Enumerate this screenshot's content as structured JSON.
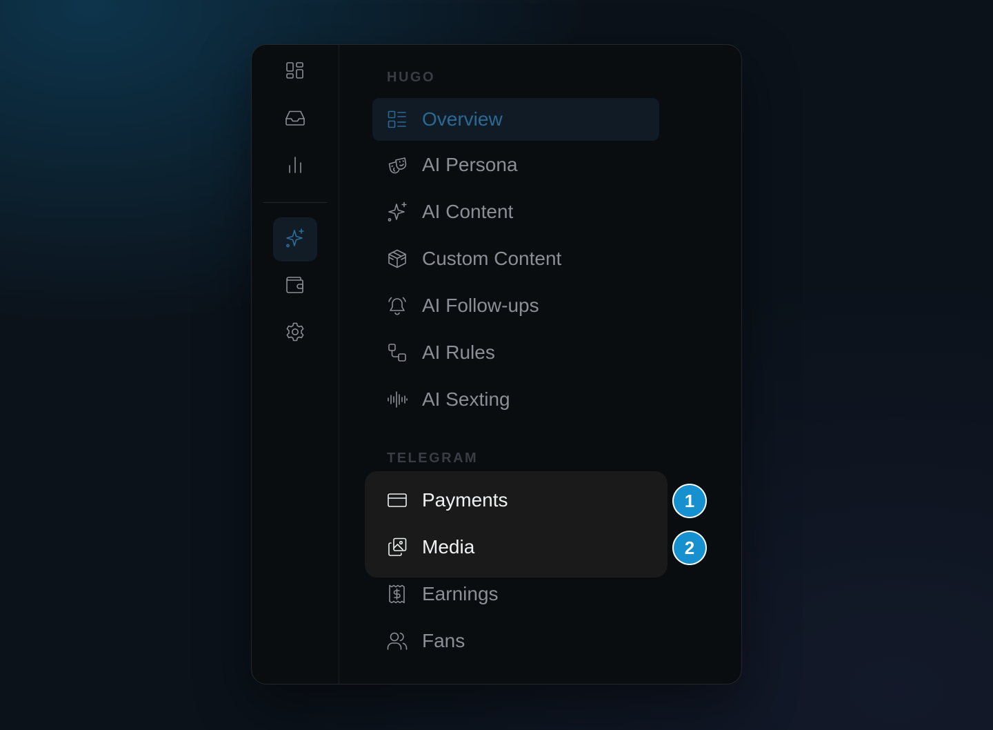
{
  "rail": {
    "items": [
      {
        "icon": "dashboard-grid-icon"
      },
      {
        "icon": "inbox-icon"
      },
      {
        "icon": "bar-chart-icon"
      },
      {
        "icon": "sparkles-icon",
        "active": true
      },
      {
        "icon": "wallet-icon"
      },
      {
        "icon": "settings-gear-icon"
      }
    ]
  },
  "sections": {
    "hugo": {
      "label": "HUGO",
      "items": [
        {
          "label": "Overview",
          "icon": "list-grid-icon",
          "active": true
        },
        {
          "label": "AI Persona",
          "icon": "theater-masks-icon"
        },
        {
          "label": "AI Content",
          "icon": "sparkles-icon"
        },
        {
          "label": "Custom Content",
          "icon": "package-box-icon"
        },
        {
          "label": "AI Follow-ups",
          "icon": "bell-ringing-icon"
        },
        {
          "label": "AI Rules",
          "icon": "workflow-icon"
        },
        {
          "label": "AI Sexting",
          "icon": "audio-waveform-icon"
        }
      ]
    },
    "telegram": {
      "label": "TELEGRAM",
      "items": [
        {
          "label": "Payments",
          "icon": "credit-card-icon",
          "highlighted": true
        },
        {
          "label": "Media",
          "icon": "image-stack-icon",
          "highlighted": true
        },
        {
          "label": "Earnings",
          "icon": "receipt-dollar-icon"
        },
        {
          "label": "Fans",
          "icon": "users-icon"
        }
      ]
    }
  },
  "badges": [
    {
      "text": "1"
    },
    {
      "text": "2"
    }
  ],
  "colors": {
    "accent": "#2a6a94",
    "badge": "#1790cf",
    "panel": "#0a0d10",
    "highlight": "#1a1a1a"
  }
}
